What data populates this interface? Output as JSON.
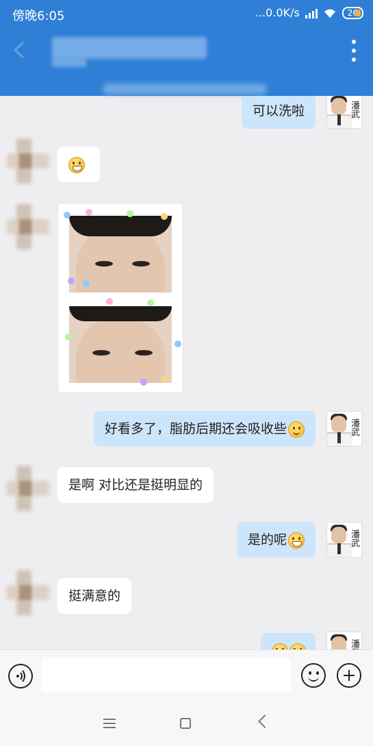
{
  "status_bar": {
    "time": "傍晚6:05",
    "network_speed": "...0.0K/s",
    "battery": "26"
  },
  "colors": {
    "header": "#2f7fd6",
    "outgoing_bubble": "#cde5fb",
    "incoming_bubble": "#ffffff",
    "chat_background": "#eeeef1"
  },
  "doctor_avatar_text": "潘武",
  "messages": [
    {
      "direction": "out",
      "text": "可以洗啦",
      "emoji": ""
    },
    {
      "direction": "in",
      "text": "",
      "emoji": "grin"
    },
    {
      "direction": "in",
      "type": "image",
      "text": ""
    },
    {
      "direction": "out",
      "text": "好看多了，脂肪后期还会吸收些",
      "emoji": "smile"
    },
    {
      "direction": "in",
      "text": "是啊 对比还是挺明显的",
      "emoji": ""
    },
    {
      "direction": "out",
      "text": "是的呢",
      "emoji": "grin"
    },
    {
      "direction": "in",
      "text": "挺满意的",
      "emoji": ""
    },
    {
      "direction": "out",
      "text": "",
      "emoji": "grin-grin"
    }
  ],
  "input": {
    "value": "",
    "placeholder": ""
  }
}
